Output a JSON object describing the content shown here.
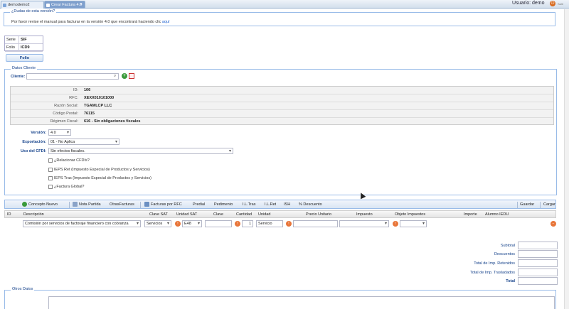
{
  "tabs": [
    {
      "label": "demodemo2"
    },
    {
      "label": "Crear Factura 4.0"
    }
  ],
  "header": {
    "user": "Usuario: demo",
    "logout": "Salir"
  },
  "notice": {
    "title": "¿Dudas de esta versión?",
    "text": "Por favor revise el manual para facturar en la versión 4.0 que encontrará haciendo clic ",
    "link": "aquí"
  },
  "folio_box": {
    "serie_label": "Serie",
    "serie_value": "SIF",
    "folio_label": "Folio",
    "folio_value": "ICD9"
  },
  "folio_button": "Folio",
  "cliente_section": {
    "legend": "Datos Cliente",
    "cliente_label": "Cliente:",
    "rows": [
      {
        "label": "ID:",
        "value": "106"
      },
      {
        "label": "RFC:",
        "value": "XEXX010101000"
      },
      {
        "label": "Razón Social:",
        "value": "TGAMLCP LLC"
      },
      {
        "label": "Código Postal:",
        "value": "76115"
      },
      {
        "label": "Régimen Fiscal:",
        "value": "616 - Sin obligaciones fiscales"
      }
    ],
    "version_label": "Versión:",
    "version_value": "4.0",
    "exportacion_label": "Exportación:",
    "exportacion_value": "01 - No Aplica",
    "uso_label": "Uso del CFDI:",
    "uso_value": "Sin efectos fiscales.",
    "checks": [
      {
        "label": "¿Relacionar CFDIs?"
      },
      {
        "label": "IEPS Ret (Impuesto Especial de Productos y Servicios)"
      },
      {
        "label": "IEPS Tras (Impuesto Especial de Productos y Servicios)"
      },
      {
        "label": "¿Factura Global?"
      }
    ]
  },
  "toolbar": {
    "items": [
      "Concepto Nuevo",
      "Nota Partida",
      "OtrasFacturas",
      "Facturas por RFC",
      "Predial",
      "Pedimento",
      "I.L.Tras",
      "I.L.Ret",
      "ISH",
      "% Descuento"
    ],
    "save": "Guardar",
    "load": "Cargar"
  },
  "grid": {
    "headers": [
      "ID",
      "Descripción",
      "Clave SAT",
      "Unidad SAT",
      "Clave",
      "Cantidad",
      "Unidad",
      "Precio Unitario",
      "Impuesto",
      "Objeto Impuestos",
      "Importe",
      "Alumno IEDU"
    ],
    "row": {
      "descripcion": "Comisión por servicios de factoraje financiero con cobranza",
      "clave_sat": "Servicios",
      "unidad_sat": "E48",
      "cantidad": "1",
      "unidad": "Servicio"
    }
  },
  "totals": [
    "Subtotal",
    "Descuentos",
    "Total de Imp. Retenidos",
    "Total de Imp. Trasladados",
    "Total"
  ],
  "otros": {
    "legend": "Otros Datos"
  },
  "colors": {
    "accent": "#15428b",
    "border": "#99bbe8",
    "orange": "#e8763a"
  }
}
